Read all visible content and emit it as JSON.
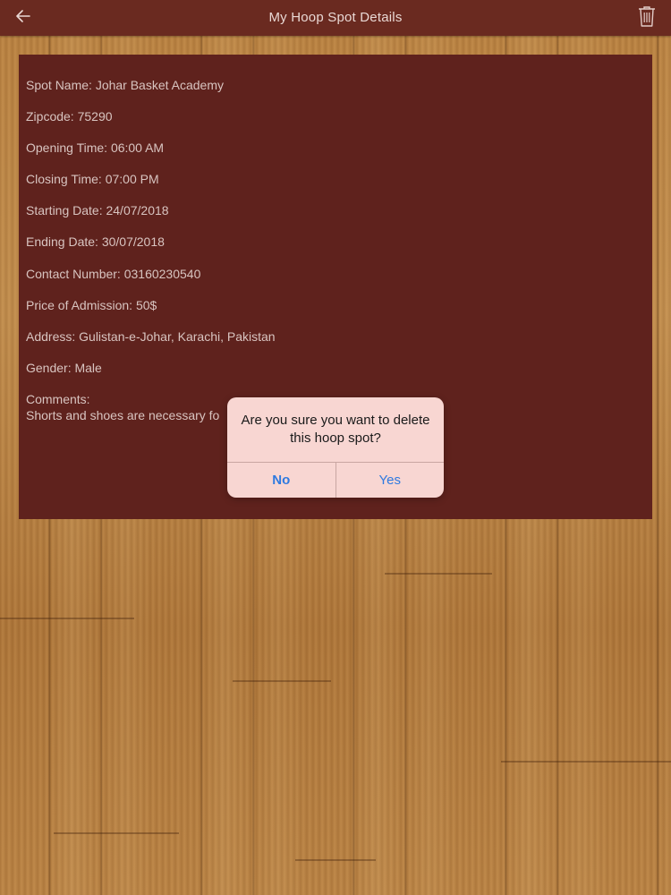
{
  "header": {
    "title": "My Hoop Spot Details",
    "back_icon": "back-arrow-icon",
    "delete_icon": "trash-icon"
  },
  "details": {
    "spot_name": "Spot Name: Johar Basket Academy",
    "zipcode": "Zipcode: 75290",
    "opening_time": "Opening Time: 06:00 AM",
    "closing_time": "Closing Time: 07:00 PM",
    "starting_date": "Starting Date: 24/07/2018",
    "ending_date": "Ending Date: 30/07/2018",
    "contact_number": "Contact Number: 03160230540",
    "price_of_admission": "Price of Admission: 50$",
    "address": "Address: Gulistan-e-Johar, Karachi, Pakistan",
    "gender": "Gender: Male",
    "comments_label": "Comments:",
    "comments_text": "Shorts and shoes are necessary fo"
  },
  "dialog": {
    "message": "Are you sure you want to delete this hoop spot?",
    "no_label": "No",
    "yes_label": "Yes"
  },
  "colors": {
    "navbar": "#6a2a20",
    "card": "#5f221d",
    "dialog_bg": "#f8d6d2",
    "button_text": "#2f7ae0"
  }
}
